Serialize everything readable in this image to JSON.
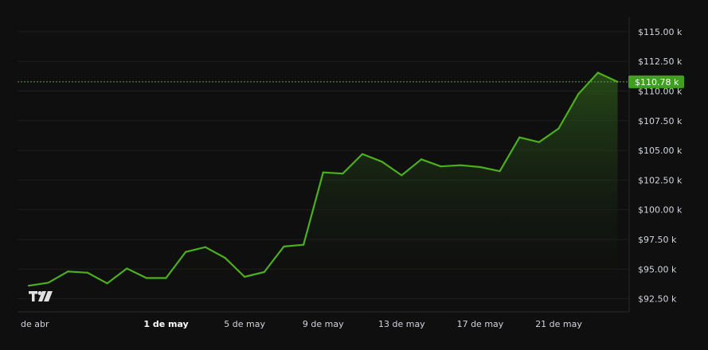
{
  "colors": {
    "background": "#0f0f0f",
    "line": "#4caf1e",
    "area_top": "#2d5c1a",
    "grid": "#1f1f1f",
    "axis_text": "#d1d4dc",
    "price_label_bg": "#3f9f1f"
  },
  "logo": {
    "icon": "tradingview-logo"
  },
  "chart_data": {
    "type": "area",
    "y_unit_prefix": "$",
    "x_tick_labels": [
      {
        "label": "de abr",
        "index": 0,
        "bold": false
      },
      {
        "label": "1 de may",
        "index": 7,
        "bold": true
      },
      {
        "label": "5 de may",
        "index": 11,
        "bold": false
      },
      {
        "label": "9 de may",
        "index": 15,
        "bold": false
      },
      {
        "label": "13 de may",
        "index": 19,
        "bold": false
      },
      {
        "label": "17 de may",
        "index": 23,
        "bold": false
      },
      {
        "label": "21 de may",
        "index": 27,
        "bold": false
      }
    ],
    "y_tick_labels": [
      "$92.50 k",
      "$95.00 k",
      "$97.50 k",
      "$100.00 k",
      "$102.50 k",
      "$105.00 k",
      "$107.50 k",
      "$110.00 k",
      "$112.50 k",
      "$115.00 k"
    ],
    "y_tick_values": [
      92500,
      95000,
      97500,
      100000,
      102500,
      105000,
      107500,
      110000,
      112500,
      115000
    ],
    "ylim": [
      91400,
      116200
    ],
    "values": [
      93600,
      93850,
      94800,
      94700,
      93800,
      95050,
      94250,
      94250,
      96450,
      96850,
      95950,
      94350,
      94750,
      96900,
      97050,
      103150,
      103050,
      104700,
      104050,
      102900,
      104250,
      103650,
      103750,
      103600,
      103250,
      106100,
      105700,
      106850,
      109750,
      111550,
      110780
    ],
    "last_value_label": "$110.78 k",
    "last_value": 110780
  }
}
